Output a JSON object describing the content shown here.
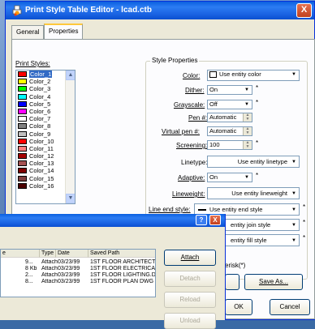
{
  "window": {
    "title": "Print Style Table Editor - lcad.ctb",
    "close_glyph": "X"
  },
  "tabs": [
    {
      "label": "General"
    },
    {
      "label": "Properties"
    }
  ],
  "print_styles": {
    "label": "Print Styles:",
    "items": [
      {
        "name": "Color_1",
        "color": "#ff0000"
      },
      {
        "name": "Color_2",
        "color": "#ffff00"
      },
      {
        "name": "Color_3",
        "color": "#00ff00"
      },
      {
        "name": "Color_4",
        "color": "#00ffff"
      },
      {
        "name": "Color_5",
        "color": "#0000ff"
      },
      {
        "name": "Color_6",
        "color": "#ff00ff"
      },
      {
        "name": "Color_7",
        "color": "#ffffff"
      },
      {
        "name": "Color_8",
        "color": "#808080"
      },
      {
        "name": "Color_9",
        "color": "#c0c0c0"
      },
      {
        "name": "Color_10",
        "color": "#ff0000"
      },
      {
        "name": "Color_11",
        "color": "#ff7f7f"
      },
      {
        "name": "Color_12",
        "color": "#a50000"
      },
      {
        "name": "Color_13",
        "color": "#a55252"
      },
      {
        "name": "Color_14",
        "color": "#7f0000"
      },
      {
        "name": "Color_15",
        "color": "#7f3f3f"
      },
      {
        "name": "Color_16",
        "color": "#4c0000"
      }
    ]
  },
  "style_properties": {
    "title": "Style Properties",
    "color": {
      "label": "Color:",
      "value": "Use entity color"
    },
    "dither": {
      "label": "Dither:",
      "value": "On"
    },
    "grayscale": {
      "label": "Grayscale:",
      "value": "Off"
    },
    "pen": {
      "label": "Pen #:",
      "value": "Automatic"
    },
    "virtual_pen": {
      "label": "Virtual pen #:",
      "value": "Automatic"
    },
    "screening": {
      "label": "Screening:",
      "value": "100"
    },
    "linetype": {
      "label": "Linetype:",
      "value": "Use entity linetype"
    },
    "adaptive": {
      "label": "Adaptive:",
      "value": "On"
    },
    "lineweight": {
      "label": "Lineweight:",
      "value": "Use entity lineweight"
    },
    "line_end_style": {
      "label": "Line end style:",
      "value": "Use entity end style"
    },
    "line_join_style": {
      "value": "entity join style"
    },
    "fill_style": {
      "value": "entity fill style"
    },
    "star": "*"
  },
  "footer": {
    "asterisk_note": "erisk(*)",
    "save_as": "Save As...",
    "ok": "OK",
    "cancel": "Cancel"
  },
  "xref_dialog": {
    "help_glyph": "?",
    "close_glyph": "X",
    "columns": [
      "e",
      "Type",
      "Date",
      "Saved Path"
    ],
    "rows": [
      {
        "size": "9...",
        "type": "Attach",
        "date": "03/23/99",
        "path": "1ST FLOOR ARCHITECT"
      },
      {
        "size": "8 Kb",
        "type": "Attach",
        "date": "03/23/99",
        "path": "1ST FLOOR ELECTRICAI"
      },
      {
        "size": "2...",
        "type": "Attach",
        "date": "03/23/99",
        "path": "1ST FLOOR LIGHTING.D"
      },
      {
        "size": "8...",
        "type": "Attach",
        "date": "03/23/99",
        "path": "1ST FLOOR PLAN DWG"
      }
    ],
    "buttons": {
      "attach": "Attach",
      "detach": "Detach",
      "reload": "Reload",
      "unload": "Unload"
    }
  }
}
